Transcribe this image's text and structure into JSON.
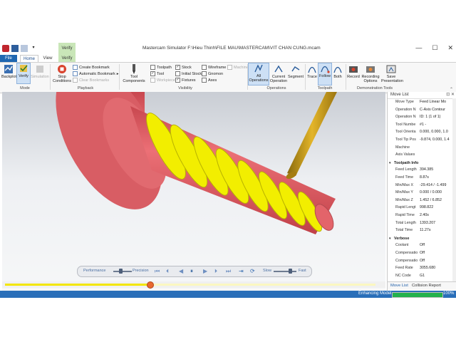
{
  "window": {
    "title": "Mastercam Simulator  F:\\Hieu Thinh\\FILE MAU\\MASTERCAM\\VIT CHAN CUNG.mcam",
    "context_tab": "Verify",
    "minimize": "—",
    "maximize": "☐",
    "close": "✕"
  },
  "tabs": {
    "file": "File",
    "home": "Home",
    "view": "View",
    "verify": "Verify"
  },
  "ribbon": {
    "mode": {
      "backplot": "Backplot",
      "verify": "Verify",
      "simulation": "Simulation",
      "label": "Mode"
    },
    "playback": {
      "stop_conditions": "Stop\nConditions",
      "create_bookmark": "Create Bookmark",
      "automatic_bookmark": "Automatic Bookmark",
      "clear_bookmarks": "Clear Bookmarks",
      "label": "Playback"
    },
    "visibility": {
      "tool_components": "Tool\nComponents",
      "toolpath": "Toolpath",
      "tool": "Tool",
      "workpiece": "Workpiece",
      "stock": "Stock",
      "initial_stock": "Initial Stock",
      "fixtures": "Fixtures",
      "wireframe": "Wireframe",
      "gnomon": "Gnomon",
      "axes": "Axes",
      "machine": "Machine",
      "label": "Visibility"
    },
    "operations": {
      "all": "All\nOperations",
      "current": "Current\nOperation",
      "segment": "Segment",
      "label": "Operations"
    },
    "toolpath": {
      "trace": "Trace",
      "follow": "Follow",
      "both": "Both",
      "label": "Toolpath"
    },
    "demo": {
      "record": "Record",
      "recording_options": "Recording\nOptions",
      "save_presentation": "Save\nPresentation",
      "label": "Demonstration Tools"
    }
  },
  "playback_bar": {
    "performance": "Performance",
    "precision": "Precision",
    "slow": "Slow",
    "fast": "Fast",
    "precision_level": 0.38,
    "speed_level": 0.72
  },
  "progress": {
    "fraction": 0.39
  },
  "move_list": {
    "title": "Move List",
    "rows": [
      {
        "k": "Move Type",
        "v": "Feed Linear Mo"
      },
      {
        "k": "Operation N",
        "v": "C-Axis Contour"
      },
      {
        "k": "Operation N",
        "v": "ID: 1 (1 of 1)"
      },
      {
        "k": "Tool Numbe",
        "v": "#1 -"
      },
      {
        "k": "Tool Orienta",
        "v": "0.000, 0.000, 1.0"
      },
      {
        "k": "Tool Tip Pos",
        "v": "-9.874, 0.000, 1.4"
      },
      {
        "k": "Machine",
        "v": ""
      },
      {
        "k": "Axis Values",
        "v": ""
      }
    ],
    "toolpath_info_label": "Toolpath Info",
    "toolpath_info": [
      {
        "k": "Feed Length",
        "v": "394.385"
      },
      {
        "k": "Feed Time",
        "v": "8.87s"
      },
      {
        "k": "Min/Max X",
        "v": "-29.414 / -1.499"
      },
      {
        "k": "Min/Max Y",
        "v": "0.000 / 0.000"
      },
      {
        "k": "Min/Max Z",
        "v": "1.452 / 6.852"
      },
      {
        "k": "Rapid Lengt",
        "v": "998.822"
      },
      {
        "k": "Rapid Time",
        "v": "2.40s"
      },
      {
        "k": "Total Length",
        "v": "1393.207"
      },
      {
        "k": "Total Time",
        "v": "11.27s"
      }
    ],
    "verbose_label": "Verbose",
    "verbose": [
      {
        "k": "Coolant",
        "v": "Off"
      },
      {
        "k": "Compensatio",
        "v": "Off"
      },
      {
        "k": "Compensatio",
        "v": "Off"
      },
      {
        "k": "Feed Rate",
        "v": "3055.680"
      },
      {
        "k": "NC Code",
        "v": "G1"
      }
    ],
    "tab_movelist": "Move List",
    "tab_collision": "Collision Report"
  },
  "status": {
    "label": "Enhancing Model",
    "percent": "100%",
    "fraction": 1.0
  },
  "colors": {
    "stock": "#e2646a",
    "thread_cut": "#f2ee00",
    "tool": "#c89a16",
    "accent": "#2a6fb9"
  },
  "icons": [
    "backplot-icon",
    "verify-icon",
    "simulation-icon",
    "stop-icon",
    "bookmark-icon",
    "tool-components-icon",
    "all-operations-icon",
    "current-operation-icon",
    "segment-icon",
    "trace-icon",
    "follow-icon",
    "both-icon",
    "record-icon",
    "recording-options-icon",
    "save-presentation-icon"
  ]
}
